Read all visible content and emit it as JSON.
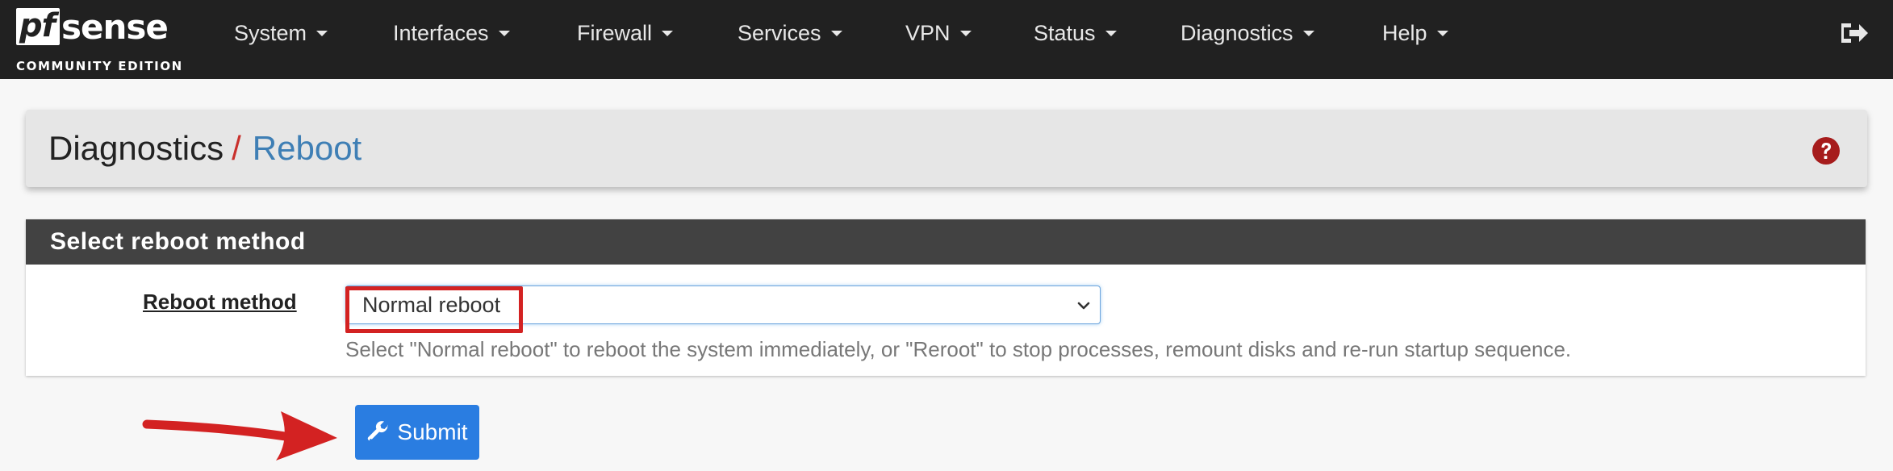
{
  "brand": {
    "logo_prefix": "pf",
    "logo_suffix": "sense",
    "edition": "COMMUNITY EDITION"
  },
  "nav": {
    "items": [
      {
        "label": "System"
      },
      {
        "label": "Interfaces"
      },
      {
        "label": "Firewall"
      },
      {
        "label": "Services"
      },
      {
        "label": "VPN"
      },
      {
        "label": "Status"
      },
      {
        "label": "Diagnostics"
      },
      {
        "label": "Help"
      }
    ],
    "logout_icon": "sign-out-icon"
  },
  "breadcrumb": {
    "parent": "Diagnostics",
    "separator": "/",
    "current": "Reboot"
  },
  "help_icon": "question-circle-icon",
  "panel": {
    "title": "Select reboot method",
    "field_label": "Reboot method",
    "select_value": "Normal reboot",
    "help_text": "Select \"Normal reboot\" to reboot the system immediately, or \"Reroot\" to stop processes, remount disks and re-run startup sequence."
  },
  "submit": {
    "label": "Submit",
    "icon": "wrench-icon"
  },
  "colors": {
    "navbar": "#212121",
    "accent_blue": "#2a7de1",
    "annotation_red": "#d32222",
    "breadcrumb_link": "#3f7fb5"
  }
}
